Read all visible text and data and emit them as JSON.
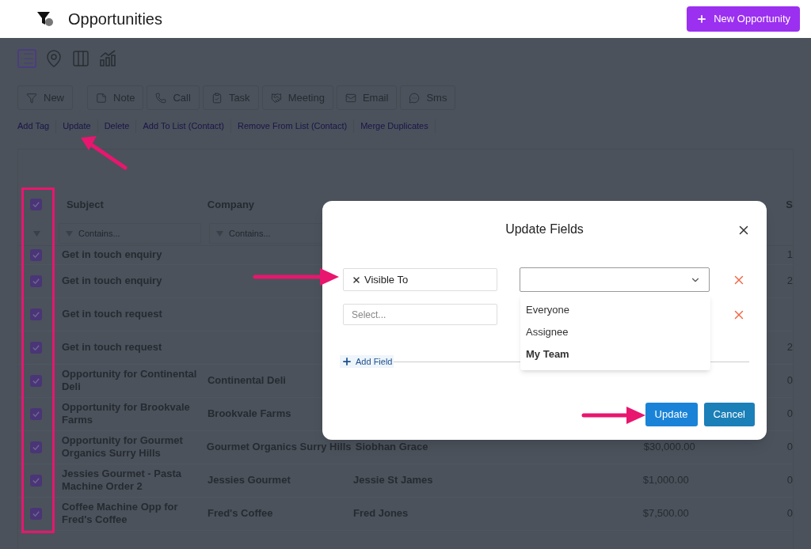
{
  "header": {
    "title": "Opportunities",
    "new_button": "New Opportunity"
  },
  "view_icons": [
    {
      "kind": "list",
      "selected": true
    },
    {
      "kind": "map",
      "selected": false
    },
    {
      "kind": "board",
      "selected": false
    },
    {
      "kind": "chart",
      "selected": false
    }
  ],
  "action_buttons": [
    {
      "kind": "filter",
      "label": "New"
    },
    {
      "kind": "note",
      "label": "Note"
    },
    {
      "kind": "call",
      "label": "Call"
    },
    {
      "kind": "task",
      "label": "Task"
    },
    {
      "kind": "meeting",
      "label": "Meeting"
    },
    {
      "kind": "email",
      "label": "Email"
    },
    {
      "kind": "sms",
      "label": "Sms"
    }
  ],
  "bulk_links": [
    "Add Tag",
    "Update",
    "Delete",
    "Add To List (Contact)",
    "Remove From List (Contact)",
    "Merge Duplicates"
  ],
  "table": {
    "select_all_checked": true,
    "columns": {
      "subject": "Subject",
      "company": "Company",
      "column_5": "S"
    },
    "filters": [
      {
        "placeholder": "Contains..."
      },
      {
        "placeholder": "Contains..."
      }
    ],
    "rows": [
      {
        "checked": true,
        "subject": "Get in touch enquiry",
        "column_5": "1"
      },
      {
        "checked": true,
        "subject": "Get in touch enquiry",
        "column_5": "2"
      },
      {
        "checked": true,
        "subject": "Get in touch request"
      },
      {
        "checked": true,
        "subject": "Get in touch request",
        "column_5": "2"
      },
      {
        "checked": true,
        "subject": "Opportunity for Continental Deli",
        "company": "Continental Deli",
        "column_5": "0"
      },
      {
        "checked": true,
        "subject": "Opportunity for Brookvale Farms",
        "company": "Brookvale Farms",
        "column_5": "0"
      },
      {
        "checked": true,
        "subject": "Opportunity for Gourmet Organics Surry Hills",
        "company": "Gourmet Organics Surry Hills",
        "contact": "Siobhan Grace",
        "value": "$30,000.00",
        "column_5": "0"
      },
      {
        "checked": true,
        "subject": "Jessies Gourmet - Pasta Machine Order 2",
        "company": "Jessies Gourmet",
        "contact": "Jessie St James",
        "value": "$1,000.00",
        "column_5": "0"
      },
      {
        "checked": true,
        "subject": "Coffee Machine Opp for Fred's Coffee",
        "company": "Fred's Coffee",
        "contact": "Fred Jones",
        "value": "$7,500.00",
        "column_5": "0"
      }
    ]
  },
  "dialog": {
    "title": "Update Fields",
    "fields": [
      {
        "field": "Visible To"
      },
      {
        "placeholder": "Select..."
      }
    ],
    "value_menu": {
      "expanded": true,
      "options": [
        {
          "label": "Everyone",
          "selected": false
        },
        {
          "label": "Assignee",
          "selected": false
        },
        {
          "label": "My Team",
          "selected": true
        }
      ]
    },
    "add_field": "Add Field",
    "buttons": {
      "update": "Update",
      "cancel": "Cancel"
    }
  }
}
